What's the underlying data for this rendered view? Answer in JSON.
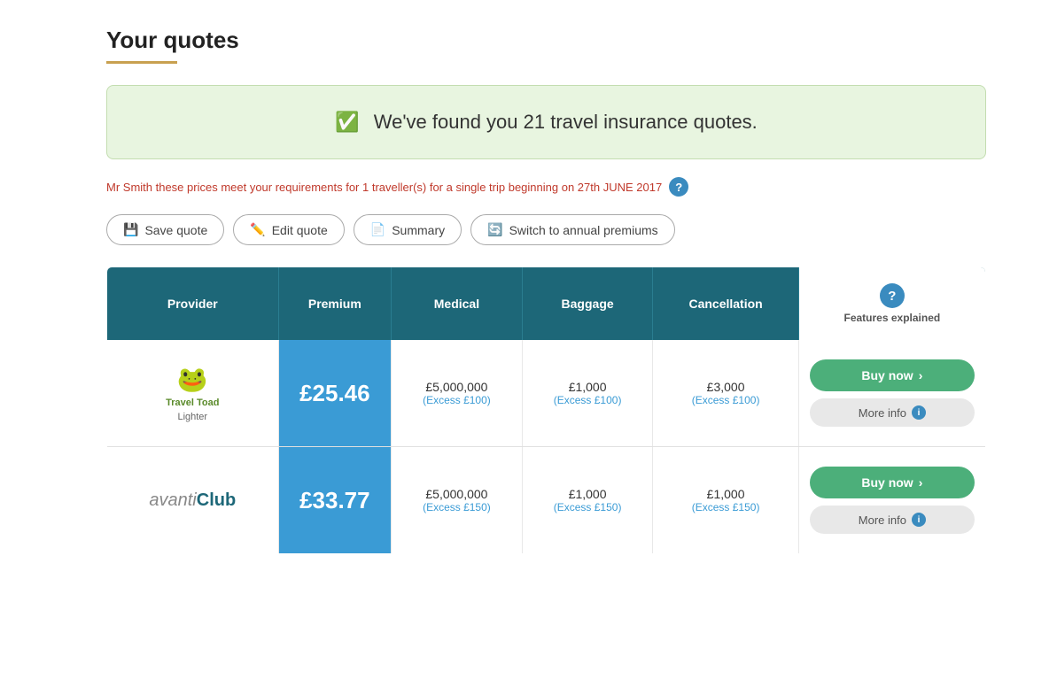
{
  "page": {
    "title": "Your quotes",
    "title_underline": true
  },
  "banner": {
    "text": "We've found you 21 travel insurance quotes."
  },
  "info_bar": {
    "text": "Mr Smith these prices meet your requirements for  1 traveller(s) for a single trip beginning on  27th JUNE 2017"
  },
  "actions": [
    {
      "id": "save",
      "icon": "💾",
      "label": "Save quote"
    },
    {
      "id": "edit",
      "icon": "✏️",
      "label": "Edit quote"
    },
    {
      "id": "summary",
      "icon": "📄",
      "label": "Summary"
    },
    {
      "id": "switch",
      "icon": "🔄",
      "label": "Switch to annual premiums"
    }
  ],
  "table": {
    "headers": [
      {
        "id": "provider",
        "label": "Provider"
      },
      {
        "id": "premium",
        "label": "Premium"
      },
      {
        "id": "medical",
        "label": "Medical"
      },
      {
        "id": "baggage",
        "label": "Baggage"
      },
      {
        "id": "cancellation",
        "label": "Cancellation"
      },
      {
        "id": "features",
        "label": "Features explained"
      }
    ],
    "rows": [
      {
        "id": "travel-toad",
        "provider_name": "Travel Toad",
        "provider_subtitle": "Lighter",
        "premium": "£25.46",
        "medical_amount": "£5,000,000",
        "medical_excess": "(Excess £100)",
        "baggage_amount": "£1,000",
        "baggage_excess": "(Excess £100)",
        "cancellation_amount": "£3,000",
        "cancellation_excess": "(Excess £100)",
        "buy_label": "Buy now",
        "more_info_label": "More info"
      },
      {
        "id": "avanti-club",
        "provider_name": "avantiClub",
        "provider_subtitle": "",
        "premium": "£33.77",
        "medical_amount": "£5,000,000",
        "medical_excess": "(Excess £150)",
        "baggage_amount": "£1,000",
        "baggage_excess": "(Excess £150)",
        "cancellation_amount": "£1,000",
        "cancellation_excess": "(Excess £150)",
        "buy_label": "Buy now",
        "more_info_label": "More info"
      }
    ]
  }
}
